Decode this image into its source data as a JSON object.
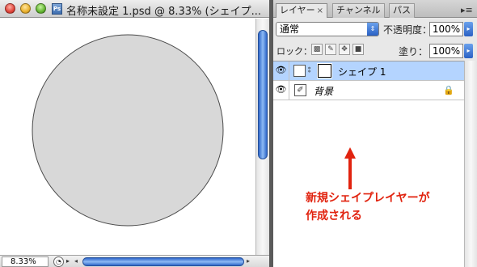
{
  "document": {
    "title": "名称未設定 1.psd @ 8.33% (シェイプ...",
    "zoom": "8.33%",
    "shape_fill_color": "#d8d8d8"
  },
  "panel": {
    "tabs": [
      {
        "label": "レイヤー",
        "close": "×"
      },
      {
        "label": "チャンネル"
      },
      {
        "label": "パス"
      }
    ],
    "menu_icon": "▸≡",
    "blend_mode": "通常",
    "opacity_label": "不透明度：",
    "opacity_value": "100%",
    "lock_label": "ロック：",
    "fill_label": "塗り：",
    "fill_value": "100%",
    "layers": [
      {
        "name": "シェイプ 1",
        "selected": true
      },
      {
        "name": "背景",
        "selected": false
      }
    ]
  },
  "annotation": {
    "text": "新規シェイプレイヤーが\n作成される",
    "color": "#e1230f"
  }
}
